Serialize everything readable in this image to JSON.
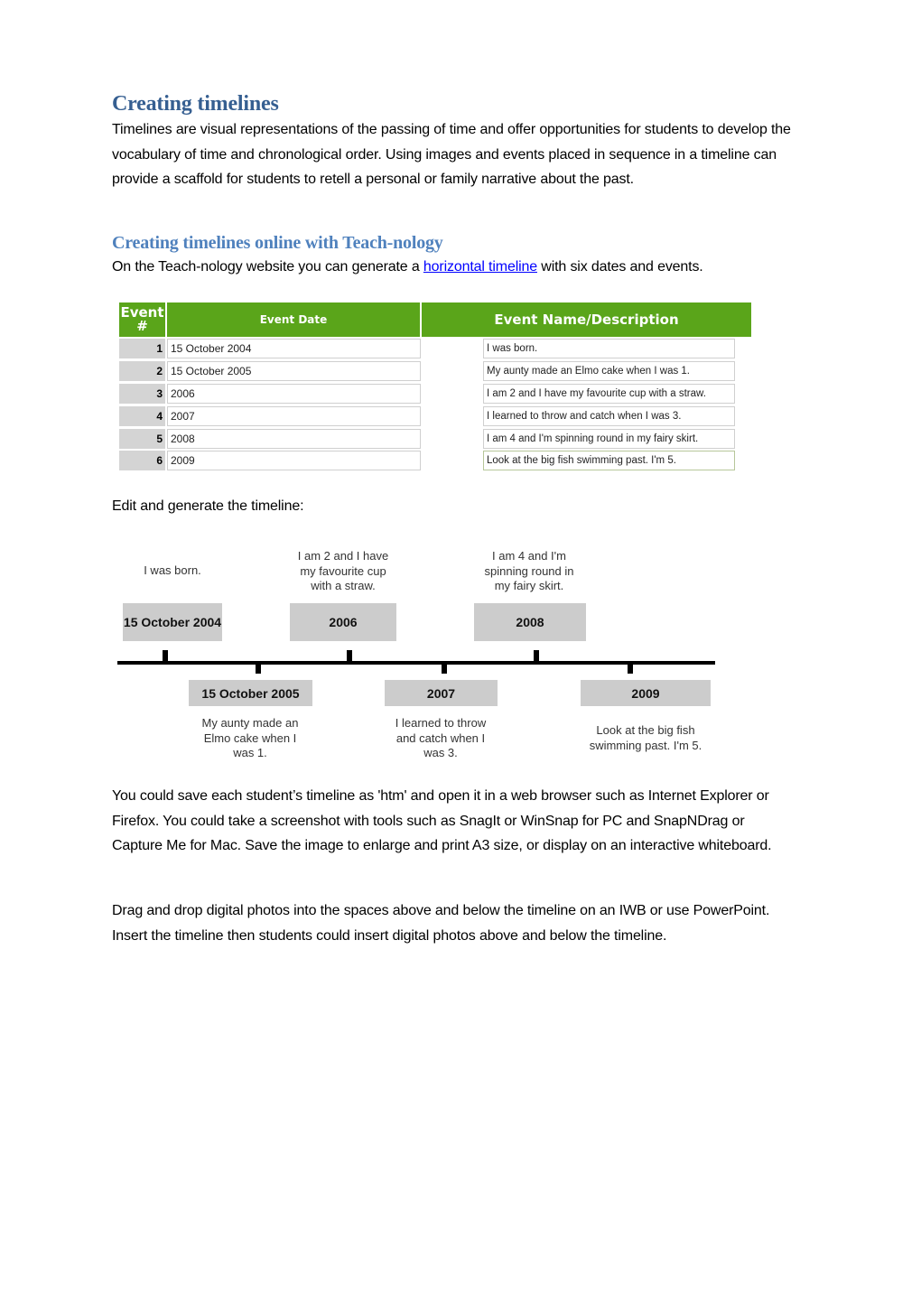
{
  "heading1": "Creating timelines",
  "intro": "Timelines are visual representations of the passing of time and offer opportunities for students to develop the vocabulary of time and chronological order. Using images and events placed in sequence in a timeline can provide a scaffold for students to retell a personal or family narrative about the past.",
  "heading2": "Creating timelines online with Teach-nology",
  "teachnology": {
    "before_link": "On the Teach-nology website you can generate a ",
    "link_text": "horizontal timeline",
    "after_link": " with six dates and events."
  },
  "form": {
    "headers": {
      "number": "Event #",
      "number_line1": "Event",
      "number_line2": "#",
      "date": "Event Date",
      "description": "Event Name/Description"
    },
    "rows": [
      {
        "number": "1",
        "date": "15 October 2004",
        "description": "I was born."
      },
      {
        "number": "2",
        "date": "15 October 2005",
        "description": "My aunty made an Elmo cake when I was 1."
      },
      {
        "number": "3",
        "date": "2006",
        "description": "I am 2 and I have my favourite cup with a straw."
      },
      {
        "number": "4",
        "date": "2007",
        "description": "I learned to throw and catch when I was 3."
      },
      {
        "number": "5",
        "date": "2008",
        "description": "I am 4 and I'm spinning round in my fairy skirt."
      },
      {
        "number": "6",
        "date": "2009",
        "description": "Look at the big fish swimming past. I'm 5."
      }
    ],
    "colors": {
      "header_bg": "#5aa51a",
      "number_bg": "#d4d4d4"
    }
  },
  "edit_label": "Edit and generate the timeline:",
  "timeline": {
    "events": [
      {
        "date": "15 October 2004",
        "caption": "I was born.",
        "position": "above"
      },
      {
        "date": "15 October 2005",
        "caption": "My aunty made an Elmo cake when I was 1.",
        "position": "below"
      },
      {
        "date": "2006",
        "caption": "I am 2 and I have my favourite cup with a straw.",
        "position": "above"
      },
      {
        "date": "2007",
        "caption": "I learned to throw and catch when I was 3.",
        "position": "below"
      },
      {
        "date": "2008",
        "caption": "I am 4 and I'm spinning round in my fairy skirt.",
        "position": "above"
      },
      {
        "date": "2009",
        "caption": "Look at the big fish swimming past. I'm 5.",
        "position": "below"
      }
    ],
    "colors": {
      "box_bg": "#cccccc",
      "axis": "#000000"
    }
  },
  "para_save": "You could save each student’s timeline as 'htm' and open it in a web browser such as Internet Explorer or Firefox. You could take a screenshot with tools such as SnagIt or WinSnap for PC and SnapNDrag or Capture Me for Mac. Save the image to enlarge and print A3 size, or display on an interactive whiteboard.",
  "para_drag": "Drag and drop digital photos into the spaces above and below the timeline on an IWB or use PowerPoint. Insert the timeline then students could insert digital photos above and below the timeline.",
  "colors": {
    "heading1": "#365f91",
    "heading2": "#4f81bd",
    "link": "#0000ff"
  }
}
